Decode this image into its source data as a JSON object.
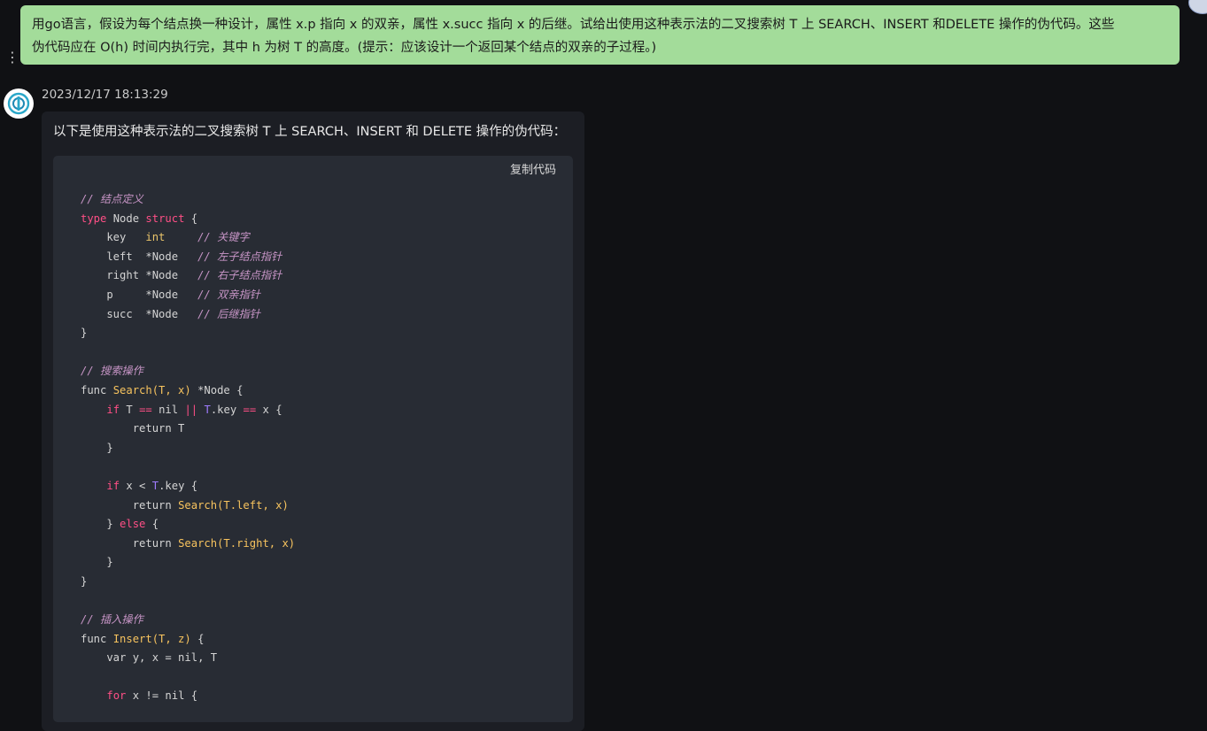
{
  "user_message": {
    "line1": "用go语言，假设为每个结点换一种设计，属性 x.p 指向 x 的双亲，属性 x.succ 指向 x 的后继。试给出使用这种表示法的二叉搜索树 T 上 SEARCH、INSERT 和DELETE  操作的伪代码。这些",
    "line2": "伪代码应在 O(h) 时间内执行完，其中 h 为树 T 的高度。(提示：应该设计一个返回某个结点的双亲的子过程。)"
  },
  "response": {
    "timestamp": "2023/12/17 18:13:29",
    "intro": "以下是使用这种表示法的二叉搜索树 T 上 SEARCH、INSERT 和 DELETE 操作的伪代码：",
    "copy_label": "复制代码",
    "code": {
      "c_node_def": "// 结点定义",
      "kw_type": "type",
      "node_name": "Node",
      "kw_struct": "struct",
      "brace_open": " {",
      "f_key": "    key   ",
      "t_int": "int",
      "c_key": "     // 关键字",
      "f_left": "    left  *Node   ",
      "c_left": "// 左子结点指针",
      "f_right": "    right *Node   ",
      "c_right": "// 右子结点指针",
      "f_p": "    p     *Node   ",
      "c_p": "// 双亲指针",
      "f_succ": "    succ  *Node   ",
      "c_succ": "// 后继指针",
      "brace_close": "}",
      "c_search": "// 搜索操作",
      "func_kw": "func ",
      "search_sig": "Search(T, x)",
      "search_ret": " *Node {",
      "if_kw": "if",
      "s_l1_a": " T ",
      "op_eq": "==",
      "s_l1_b": " nil ",
      "op_or": "||",
      "T_var": "T",
      "s_l1_c": ".key ",
      "s_l1_d": " x {",
      "return_T": "        return T",
      "close4": "    }",
      "s_l2_a": " x < ",
      "s_l2_b": ".key {",
      "return_kw": "        return ",
      "search_left": "Search(T.left, x)",
      "else_open": "    } ",
      "else_kw": "else",
      "else_brace": " {",
      "search_right": "Search(T.right, x)",
      "c_insert": "// 插入操作",
      "insert_sig": "Insert(T, z)",
      "insert_brace": " {",
      "var_line": "    var y, x = nil, T",
      "for_kw": "for",
      "for_rest": " x != nil {"
    }
  }
}
